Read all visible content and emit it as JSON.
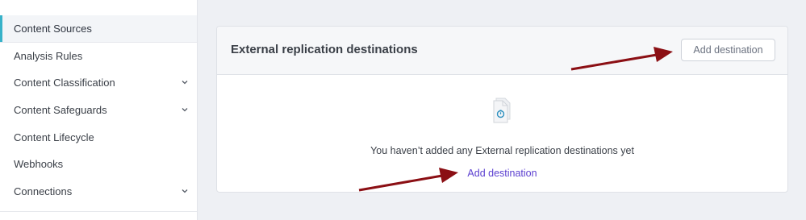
{
  "sidebar": {
    "items": [
      {
        "label": "Content Sources",
        "active": true,
        "has_submenu": false
      },
      {
        "label": "Analysis Rules",
        "active": false,
        "has_submenu": false
      },
      {
        "label": "Content Classification",
        "active": false,
        "has_submenu": true
      },
      {
        "label": "Content Safeguards",
        "active": false,
        "has_submenu": true
      },
      {
        "label": "Content Lifecycle",
        "active": false,
        "has_submenu": false
      },
      {
        "label": "Webhooks",
        "active": false,
        "has_submenu": false
      },
      {
        "label": "Connections",
        "active": false,
        "has_submenu": true
      }
    ]
  },
  "card": {
    "title": "External replication destinations",
    "add_button_label": "Add destination",
    "empty_icon": "document-clock-icon",
    "empty_message": "You haven’t added any External replication destinations yet",
    "empty_link_label": "Add destination"
  },
  "colors": {
    "accent_active": "#38b2c9",
    "link": "#5b3fd0",
    "annotation_arrow": "#8b0f14",
    "page_background": "#eef0f4"
  }
}
